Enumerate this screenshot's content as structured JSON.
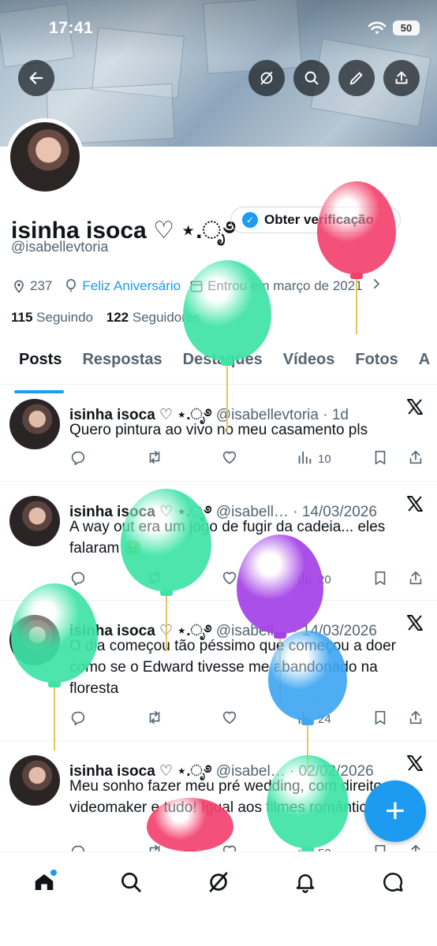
{
  "status_bar": {
    "time": "17:41",
    "battery": "50"
  },
  "profile": {
    "display_name": "isinha isoca ♡ ⋆.ೃ࿔",
    "handle": "@isabellevtoria",
    "verify_label": "Obter verificação",
    "location": "237",
    "birthday_link": "Feliz Aniversário",
    "joined": "Entrou em março de 2021",
    "following_count": "115",
    "following_label": "Seguindo",
    "followers_count": "122",
    "followers_label": "Seguidores"
  },
  "tabs": [
    "Posts",
    "Respostas",
    "Destaques",
    "Vídeos",
    "Fotos",
    "A"
  ],
  "posts": [
    {
      "name": "isinha isoca ♡ ⋆.ೃ࿔",
      "handle_time": "@isabellevtoria · 1d",
      "text": "Quero pintura ao vivo no meu casamento pls",
      "views": "10"
    },
    {
      "name": "isinha isoca ♡ ⋆.ೃ࿔",
      "handle_time": "@isabell… · 14/03/2026",
      "text": "A way out era um jogo de fugir da cadeia... eles falaram 🤢",
      "views": "20"
    },
    {
      "name": "isinha isoca ♡ ⋆.ೃ࿔",
      "handle_time": "@isabell… · 14/03/2026",
      "text": "O dia começou tão péssimo que começou a doer como se o Edward tivesse me abandonado na floresta",
      "views": "24"
    },
    {
      "name": "isinha isoca ♡ ⋆.ೃ࿔",
      "handle_time": "@isabel… · 02/02/2026",
      "text": "Meu sonho fazer meu pré wedding, com direito a videomaker e tudo! Igual aos filmes românticos",
      "views": "52"
    }
  ],
  "colors": {
    "accent": "#1d9bf0",
    "balloon_pink": "#f2426d",
    "balloon_green": "#3ee3a6",
    "balloon_purple": "#a341e6",
    "balloon_blue": "#3ea6f2"
  },
  "icons": {
    "back": "arrow-left-icon",
    "hide": "slash-circle-icon",
    "search": "search-icon",
    "edit": "pencil-icon",
    "share": "share-icon",
    "nav": [
      "home-icon",
      "search-icon",
      "grok-icon",
      "bell-icon",
      "messages-icon"
    ]
  }
}
